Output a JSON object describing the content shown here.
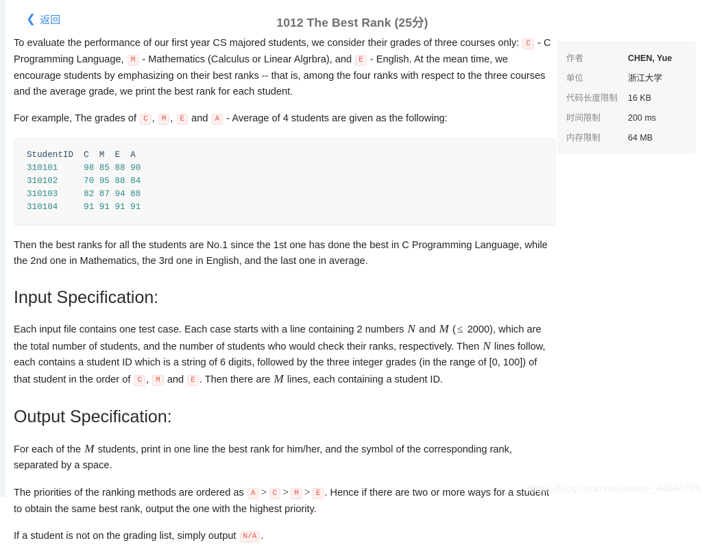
{
  "header": {
    "back_label": "返回",
    "back_icon": "chevron-left-icon",
    "title": "1012 The Best Rank (25分)"
  },
  "info_panel": {
    "rows": [
      {
        "label": "作者",
        "value": "CHEN, Yue",
        "bold": true
      },
      {
        "label": "单位",
        "value": "浙江大学",
        "bold": false
      },
      {
        "label": "代码长度限制",
        "value": "16 KB",
        "bold": false
      },
      {
        "label": "时间限制",
        "value": "200 ms",
        "bold": false
      },
      {
        "label": "内存限制",
        "value": "64 MB",
        "bold": false
      }
    ]
  },
  "content": {
    "p1": {
      "t1": "To evaluate the performance of our first year CS majored students, we consider their grades of three courses only: ",
      "c1": "C",
      "t2": " - C Programming Language, ",
      "c2": "M",
      "t3": " - Mathematics (Calculus or Linear Algrbra), and ",
      "c3": "E",
      "t4": " - English. At the mean time, we encourage students by emphasizing on their best ranks -- that is, among the four ranks with respect to the three courses and the average grade, we print the best rank for each student."
    },
    "p2": {
      "t1": "For example, The grades of ",
      "c1": "C",
      "t2": ", ",
      "c2": "M",
      "t3": ", ",
      "c3": "E",
      "t4": " and ",
      "c4": "A",
      "t5": " - Average of 4 students are given as the following:"
    },
    "code_block": {
      "header_line": "StudentID  C  M  E  A",
      "rows": [
        "310101     98 85 88 90",
        "310102     70 95 88 84",
        "310103     82 87 94 88",
        "310104     91 91 91 91"
      ]
    },
    "p3": "Then the best ranks for all the students are No.1 since the 1st one has done the best in C Programming Language, while the 2nd one in Mathematics, the 3rd one in English, and the last one in average.",
    "input_spec_heading": "Input Specification:",
    "p4": {
      "t1": "Each input file contains one test case. Each case starts with a line containing 2 numbers ",
      "m1": "N",
      "t2": " and ",
      "m2": "M",
      "t3": " (",
      "rel1": "≤",
      "t4": " 2000), which are the total number of students, and the number of students who would check their ranks, respectively. Then ",
      "m3": "N",
      "t5": " lines follow, each contains a student ID which is a string of 6 digits, followed by the three integer grades (in the range of [0, 100]) of that student in the order of ",
      "c1": "C",
      "t6": ", ",
      "c2": "M",
      "t7": " and ",
      "c3": "E",
      "t8": ". Then there are ",
      "m4": "M",
      "t9": " lines, each containing a student ID."
    },
    "output_spec_heading": "Output Specification:",
    "p5": {
      "t1": "For each of the ",
      "m1": "M",
      "t2": " students, print in one line the best rank for him/her, and the symbol of the corresponding rank, separated by a space."
    },
    "p6": {
      "t1": "The priorities of the ranking methods are ordered as ",
      "c1": "A",
      "rel1": ">",
      "c2": "C",
      "rel2": ">",
      "c3": "M",
      "rel3": ">",
      "c4": "E",
      "t2": ". Hence if there are two or more ways for a student to obtain the same best rank, output the one with the highest priority."
    },
    "p7": {
      "t1": "If a student is not on the grading list, simply output ",
      "c1": "N/A",
      "t2": "."
    }
  },
  "watermark": "https://blog.csdn.net/weixin_44046769",
  "colors": {
    "link_blue": "#3a8ee6",
    "title_gray": "#707070",
    "badge_text": "#e8584f",
    "badge_bg": "#fdf1f0",
    "code_teal": "#2a8a86",
    "panel_bg": "#f7f7f7"
  }
}
